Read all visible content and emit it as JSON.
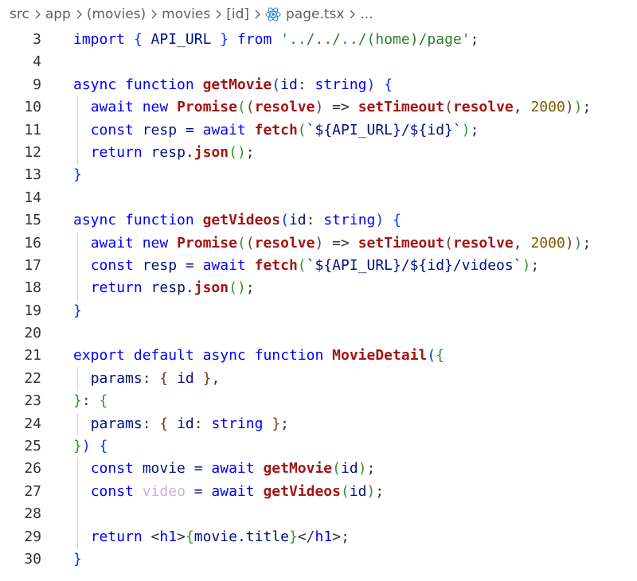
{
  "breadcrumb": {
    "items": [
      "src",
      "app",
      "(movies)",
      "movies",
      "[id]",
      "page.tsx",
      "..."
    ]
  },
  "lines": [
    {
      "n": "3",
      "indent": 0,
      "tokens": [
        [
          "import",
          "kw"
        ],
        [
          " ",
          "p"
        ],
        [
          "{",
          "b1"
        ],
        [
          " API_URL ",
          "id"
        ],
        [
          "}",
          "b1"
        ],
        [
          " ",
          "p"
        ],
        [
          "from",
          "kw"
        ],
        [
          " ",
          "p"
        ],
        [
          "'../../../(",
          "str"
        ],
        [
          "home",
          "str"
        ],
        [
          ")/page'",
          "str"
        ],
        [
          ";",
          "p"
        ]
      ]
    },
    {
      "n": "4",
      "indent": 0,
      "tokens": []
    },
    {
      "n": "9",
      "indent": 0,
      "tokens": [
        [
          "async",
          "kw"
        ],
        [
          " ",
          "p"
        ],
        [
          "function",
          "kw"
        ],
        [
          " ",
          "p"
        ],
        [
          "getMovie",
          "fn"
        ],
        [
          "(",
          "b1"
        ],
        [
          "id",
          "param"
        ],
        [
          ": ",
          "p"
        ],
        [
          "string",
          "ty"
        ],
        [
          ")",
          "b1"
        ],
        [
          " ",
          "p"
        ],
        [
          "{",
          "b1"
        ]
      ]
    },
    {
      "n": "10",
      "indent": 1,
      "tokens": [
        [
          "await",
          "ctl"
        ],
        [
          " ",
          "p"
        ],
        [
          "new",
          "kw"
        ],
        [
          " ",
          "p"
        ],
        [
          "Promise",
          "fn"
        ],
        [
          "(",
          "b2"
        ],
        [
          "(",
          "b3"
        ],
        [
          "resolve",
          "fn"
        ],
        [
          ")",
          "b3"
        ],
        [
          " => ",
          "p"
        ],
        [
          "setTimeout",
          "fn"
        ],
        [
          "(",
          "b3"
        ],
        [
          "resolve",
          "fn"
        ],
        [
          ", ",
          "p"
        ],
        [
          "2000",
          "num"
        ],
        [
          ")",
          "b3"
        ],
        [
          ")",
          "b2"
        ],
        [
          ";",
          "p"
        ]
      ]
    },
    {
      "n": "11",
      "indent": 1,
      "tokens": [
        [
          "const",
          "kw"
        ],
        [
          " resp = ",
          "id"
        ],
        [
          "await",
          "ctl"
        ],
        [
          " ",
          "p"
        ],
        [
          "fetch",
          "fn"
        ],
        [
          "(",
          "b2"
        ],
        [
          "`${API_URL}/${id}`",
          "id"
        ],
        [
          ")",
          "b2"
        ],
        [
          ";",
          "p"
        ]
      ]
    },
    {
      "n": "12",
      "indent": 1,
      "tokens": [
        [
          "return",
          "ctl"
        ],
        [
          " resp.",
          "id"
        ],
        [
          "json",
          "fn"
        ],
        [
          "(",
          "b2"
        ],
        [
          ")",
          "b2"
        ],
        [
          ";",
          "p"
        ]
      ]
    },
    {
      "n": "13",
      "indent": 0,
      "tokens": [
        [
          "}",
          "b1"
        ]
      ]
    },
    {
      "n": "14",
      "indent": 0,
      "tokens": []
    },
    {
      "n": "15",
      "indent": 0,
      "tokens": [
        [
          "async",
          "kw"
        ],
        [
          " ",
          "p"
        ],
        [
          "function",
          "kw"
        ],
        [
          " ",
          "p"
        ],
        [
          "getVideos",
          "fn"
        ],
        [
          "(",
          "b1"
        ],
        [
          "id",
          "param"
        ],
        [
          ": ",
          "p"
        ],
        [
          "string",
          "ty"
        ],
        [
          ")",
          "b1"
        ],
        [
          " ",
          "p"
        ],
        [
          "{",
          "b1"
        ]
      ]
    },
    {
      "n": "16",
      "indent": 1,
      "tokens": [
        [
          "await",
          "ctl"
        ],
        [
          " ",
          "p"
        ],
        [
          "new",
          "kw"
        ],
        [
          " ",
          "p"
        ],
        [
          "Promise",
          "fn"
        ],
        [
          "(",
          "b2"
        ],
        [
          "(",
          "b3"
        ],
        [
          "resolve",
          "fn"
        ],
        [
          ")",
          "b3"
        ],
        [
          " => ",
          "p"
        ],
        [
          "setTimeout",
          "fn"
        ],
        [
          "(",
          "b3"
        ],
        [
          "resolve",
          "fn"
        ],
        [
          ", ",
          "p"
        ],
        [
          "2000",
          "num"
        ],
        [
          ")",
          "b3"
        ],
        [
          ")",
          "b2"
        ],
        [
          ";",
          "p"
        ]
      ]
    },
    {
      "n": "17",
      "indent": 1,
      "tokens": [
        [
          "const",
          "kw"
        ],
        [
          " resp = ",
          "id"
        ],
        [
          "await",
          "ctl"
        ],
        [
          " ",
          "p"
        ],
        [
          "fetch",
          "fn"
        ],
        [
          "(",
          "b2"
        ],
        [
          "`${API_URL}/${id}/videos`",
          "id"
        ],
        [
          ")",
          "b2"
        ],
        [
          ";",
          "p"
        ]
      ]
    },
    {
      "n": "18",
      "indent": 1,
      "tokens": [
        [
          "return",
          "ctl"
        ],
        [
          " resp.",
          "id"
        ],
        [
          "json",
          "fn"
        ],
        [
          "(",
          "b2"
        ],
        [
          ")",
          "b2"
        ],
        [
          ";",
          "p"
        ]
      ]
    },
    {
      "n": "19",
      "indent": 0,
      "tokens": [
        [
          "}",
          "b1"
        ]
      ]
    },
    {
      "n": "20",
      "indent": 0,
      "tokens": []
    },
    {
      "n": "21",
      "indent": 0,
      "tokens": [
        [
          "export",
          "ctl"
        ],
        [
          " ",
          "p"
        ],
        [
          "default",
          "ctl"
        ],
        [
          " ",
          "p"
        ],
        [
          "async",
          "kw"
        ],
        [
          " ",
          "p"
        ],
        [
          "function",
          "kw"
        ],
        [
          " ",
          "p"
        ],
        [
          "MovieDetail",
          "fn"
        ],
        [
          "(",
          "b1"
        ],
        [
          "{",
          "b2"
        ]
      ]
    },
    {
      "n": "22",
      "indent": 1,
      "tokens": [
        [
          "params",
          "id"
        ],
        [
          ": ",
          "p"
        ],
        [
          "{",
          "b3"
        ],
        [
          " id ",
          "id"
        ],
        [
          "}",
          "b3"
        ],
        [
          ",",
          "p"
        ]
      ]
    },
    {
      "n": "23",
      "indent": 0,
      "tokens": [
        [
          "}",
          "b2"
        ],
        [
          ": ",
          "p"
        ],
        [
          "{",
          "b2"
        ]
      ]
    },
    {
      "n": "24",
      "indent": 1,
      "tokens": [
        [
          "params",
          "id"
        ],
        [
          ": ",
          "p"
        ],
        [
          "{",
          "b3"
        ],
        [
          " id",
          "id"
        ],
        [
          ": ",
          "p"
        ],
        [
          "string",
          "ty"
        ],
        [
          " ",
          "p"
        ],
        [
          "}",
          "b3"
        ],
        [
          ";",
          "p"
        ]
      ]
    },
    {
      "n": "25",
      "indent": 0,
      "tokens": [
        [
          "}",
          "b2"
        ],
        [
          ")",
          "b1"
        ],
        [
          " ",
          "p"
        ],
        [
          "{",
          "b1"
        ]
      ]
    },
    {
      "n": "26",
      "indent": 1,
      "tokens": [
        [
          "const",
          "kw"
        ],
        [
          " movie = ",
          "id"
        ],
        [
          "await",
          "ctl"
        ],
        [
          " ",
          "p"
        ],
        [
          "getMovie",
          "fn"
        ],
        [
          "(",
          "b2"
        ],
        [
          "id",
          "id"
        ],
        [
          ")",
          "b2"
        ],
        [
          ";",
          "p"
        ]
      ]
    },
    {
      "n": "27",
      "indent": 1,
      "tokens": [
        [
          "const",
          "kw"
        ],
        [
          " ",
          "p"
        ],
        [
          "video",
          "dim"
        ],
        [
          " = ",
          "id"
        ],
        [
          "await",
          "ctl"
        ],
        [
          " ",
          "p"
        ],
        [
          "getVideos",
          "fn"
        ],
        [
          "(",
          "b2"
        ],
        [
          "id",
          "id"
        ],
        [
          ")",
          "b2"
        ],
        [
          ";",
          "p"
        ]
      ]
    },
    {
      "n": "28",
      "indent": 1,
      "tokens": []
    },
    {
      "n": "29",
      "indent": 1,
      "tokens": [
        [
          "return",
          "ctl"
        ],
        [
          " <",
          "p"
        ],
        [
          "h1",
          "kw"
        ],
        [
          ">",
          "p"
        ],
        [
          "{",
          "b2"
        ],
        [
          "movie.title",
          "id"
        ],
        [
          "}",
          "b2"
        ],
        [
          "</",
          "p"
        ],
        [
          "h1",
          "kw"
        ],
        [
          ">",
          "p"
        ],
        [
          ";",
          "p"
        ]
      ]
    },
    {
      "n": "30",
      "indent": 0,
      "tokens": [
        [
          "}",
          "b1"
        ]
      ]
    }
  ]
}
